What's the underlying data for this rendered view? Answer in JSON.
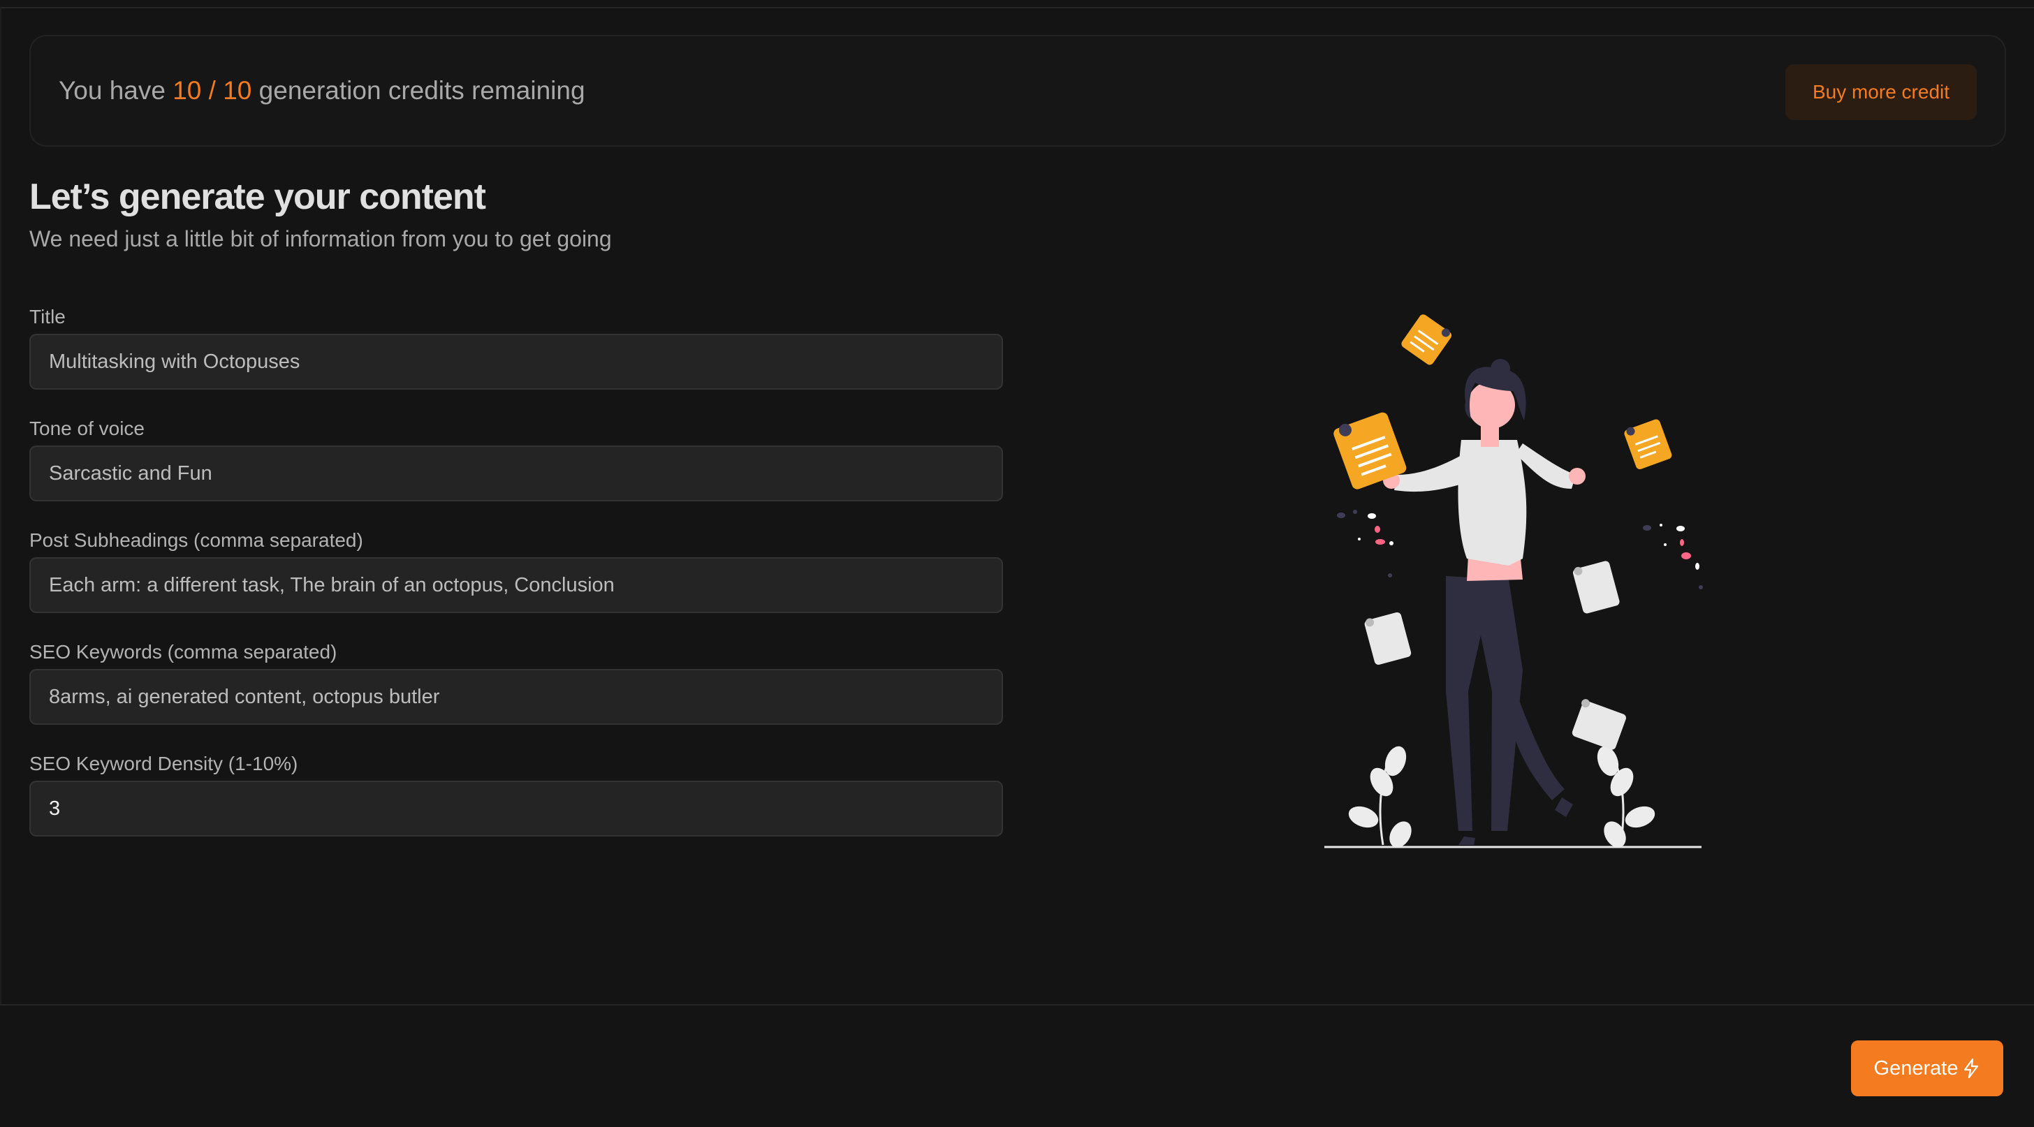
{
  "credits": {
    "prefix": "You have",
    "count": "10 / 10",
    "suffix": "generation credits remaining",
    "buy_label": "Buy more credit"
  },
  "intro": {
    "title": "Let’s generate your content",
    "subtitle": "We need just a little bit of information from you to get going"
  },
  "form": {
    "title": {
      "label": "Title",
      "value": "Multitasking with Octopuses"
    },
    "tone": {
      "label": "Tone of voice",
      "value": "Sarcastic and Fun"
    },
    "subheadings": {
      "label": "Post Subheadings (comma separated)",
      "value": "Each arm: a different task, The brain of an octopus, Conclusion"
    },
    "keywords": {
      "label": "SEO Keywords (comma separated)",
      "value": "8arms, ai generated content, octopus butler"
    },
    "density": {
      "label": "SEO Keyword Density (1-10%)",
      "value": "3"
    }
  },
  "footer": {
    "generate_label": "Generate"
  },
  "illustration": {
    "name": "woman-juggling-notes-illustration"
  },
  "colors": {
    "accent": "#f47b20",
    "background": "#141414",
    "input_bg": "#242424",
    "note": "#f5a623"
  },
  "icons": {
    "generate": "lightning-bolt-icon"
  }
}
